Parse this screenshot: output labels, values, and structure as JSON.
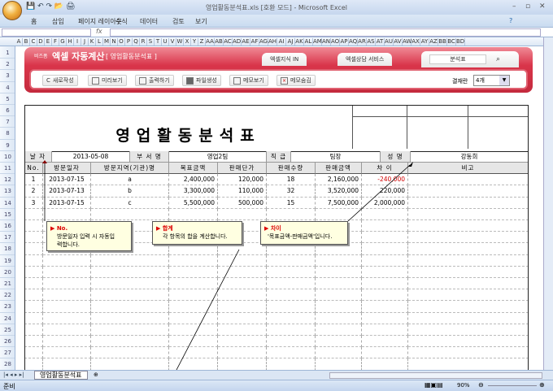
{
  "window": {
    "title": "영업활동분석표.xls  [호환 모드] - Microsoft Excel"
  },
  "ribbon_tabs": [
    "홈",
    "삽입",
    "페이지 레이아웃",
    "수식",
    "데이터",
    "검토",
    "보기"
  ],
  "columns": [
    "A",
    "B",
    "C",
    "D",
    "E",
    "F",
    "G",
    "H",
    "I",
    "J",
    "K",
    "L",
    "M",
    "N",
    "O",
    "P",
    "Q",
    "R",
    "S",
    "T",
    "U",
    "V",
    "W",
    "X",
    "Y",
    "Z",
    "AA",
    "AB",
    "AC",
    "AD",
    "AE",
    "AF",
    "AG",
    "AH",
    "AI",
    "AJ",
    "AK",
    "AL",
    "AM",
    "AN",
    "AO",
    "AP",
    "AQ",
    "AR",
    "AS",
    "AT",
    "AU",
    "AV",
    "AW",
    "AX",
    "AY",
    "AZ",
    "BB",
    "BC",
    "BD"
  ],
  "rows": [
    "1",
    "2",
    "3",
    "4",
    "5",
    "6",
    "7",
    "8",
    "9",
    "10",
    "11",
    "12",
    "13",
    "14",
    "15",
    "16",
    "17",
    "18",
    "19",
    "20",
    "21",
    "22",
    "23",
    "24",
    "25",
    "26",
    "27",
    "28"
  ],
  "banner": {
    "brand": "비즈폼",
    "title": "엑셀 자동계산",
    "subtitle": "[ 영업활동분석표 ]",
    "tab1": "엑셀지식 IN",
    "tab2": "엑셀상담 서비스",
    "search_value": "분석표",
    "buttons": [
      "새로작성",
      "미리보기",
      "출력하기",
      "파일생성",
      "메모보기",
      "메모숨김"
    ],
    "approval_label": "결재란",
    "approval_value": "4개"
  },
  "sheet": {
    "title": "영업활동분석표",
    "info": {
      "date_label": "날 자",
      "date": "2013-05-08",
      "dept_label": "부 서 명",
      "dept": "영업2팀",
      "rank_label": "직 급",
      "rank": "팀장",
      "name_label": "성 명",
      "name": "강동희"
    },
    "headers": [
      "No.",
      "방문일자",
      "방문지역(기관)명",
      "목표금액",
      "판매단가",
      "판매수량",
      "판매금액",
      "차  이",
      "비고"
    ],
    "rows": [
      [
        "1",
        "2013-07-15",
        "a",
        "2,400,000",
        "120,000",
        "18",
        "2,160,000",
        "-240,000",
        ""
      ],
      [
        "2",
        "2013-07-13",
        "b",
        "3,300,000",
        "110,000",
        "32",
        "3,520,000",
        "220,000",
        ""
      ],
      [
        "3",
        "2013-07-15",
        "c",
        "5,500,000",
        "500,000",
        "15",
        "7,500,000",
        "2,000,000",
        ""
      ]
    ],
    "negative_color": "#d00000"
  },
  "callouts": [
    {
      "title": "No.",
      "text": "방문일자 입력 시 자동입력합니다."
    },
    {
      "title": "합계",
      "text": "각 항목의 합을 계산합니다."
    },
    {
      "title": "차이",
      "text": "'목표금액-판매금액'입니다."
    }
  ],
  "sheet_tab": "영업활동분석표",
  "status": {
    "ready": "준비",
    "zoom": "90%"
  }
}
